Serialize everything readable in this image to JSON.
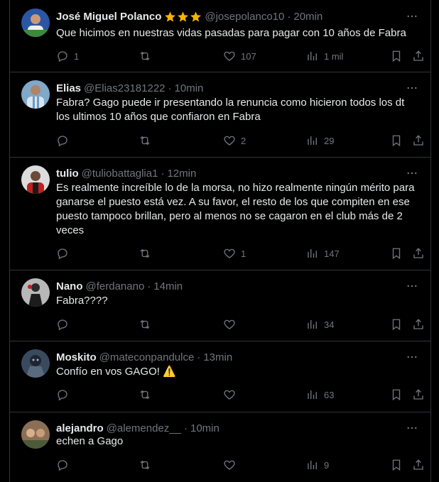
{
  "tweets": [
    {
      "name": "José Miguel Polanco",
      "handle": "@josepolanco10",
      "time": "20min",
      "text": [
        "Que hicimos en nuestras vidas pasadas para pagar con 10 años de Fabra"
      ],
      "replies": "1",
      "likes": "107",
      "views": "1 mil",
      "stars": 3,
      "avatar_color": "#2a56a5"
    },
    {
      "name": "Elias",
      "handle": "@Elias23181222",
      "time": "10min",
      "text": [
        "Fabra? Gago puede ir presentando la renuncia como hicieron todos los dt",
        "los ultimos 10 años que confiaron en Fabra"
      ],
      "replies": "",
      "likes": "2",
      "views": "29",
      "avatar_color": "#7fa8c9"
    },
    {
      "name": "tulio",
      "handle": "@tuliobattaglia1",
      "time": "12min",
      "text": [
        "Es realmente increíble lo de la morsa, no hizo realmente ningún mérito para",
        "ganarse el puesto está vez. A su favor, el resto de los que compiten en ese",
        "puesto tampoco brillan, pero al menos no se cagaron en el club más de 2",
        "veces"
      ],
      "replies": "",
      "likes": "1",
      "views": "147",
      "avatar_color": "#6b4a3a"
    },
    {
      "name": "Nano",
      "handle": "@ferdanano",
      "time": "14min",
      "text": [
        "Fabra????"
      ],
      "replies": "",
      "likes": "",
      "views": "34",
      "avatar_color": "#8a8a8a"
    },
    {
      "name": "Moskito",
      "handle": "@mateconpandulce",
      "time": "13min",
      "text": [
        "Confío en vos GAGO! ⚠️"
      ],
      "replies": "",
      "likes": "",
      "views": "63",
      "avatar_color": "#3a4a5e"
    },
    {
      "name": "alejandro",
      "handle": "@alemendez__",
      "time": "10min",
      "text": [
        "echen a Gago"
      ],
      "replies": "",
      "likes": "",
      "views": "9",
      "avatar_color": "#8b6f55"
    }
  ],
  "icons": {
    "reply": "reply-icon",
    "retweet": "retweet-icon",
    "like": "heart-icon",
    "views": "views-icon",
    "bookmark": "bookmark-icon",
    "share": "share-icon",
    "more": "more-icon",
    "star": "star-icon"
  },
  "colors": {
    "background": "#000000",
    "text": "#e7e9ea",
    "secondary": "#71767b",
    "border": "#2f3336",
    "star": "#f4b400"
  }
}
